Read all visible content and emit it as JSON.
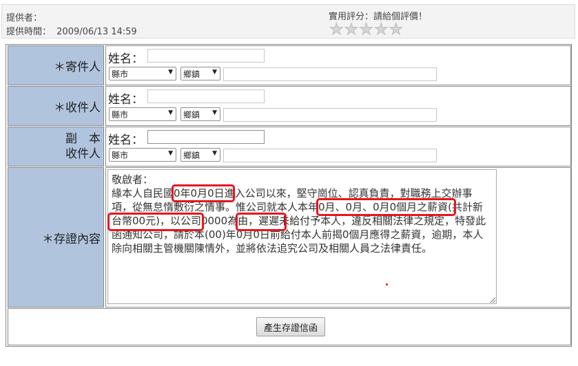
{
  "meta": {
    "provider_label": "提供者：",
    "time_label": "提供時間：",
    "time_value": "2009/06/13 14:59"
  },
  "rating": {
    "label": "實用評分：請給個評價！",
    "stars": 5,
    "value": 0
  },
  "form": {
    "sender": {
      "label": "＊寄件人",
      "name_label": "姓名：",
      "city_select": "縣市",
      "town_select": "鄉鎮"
    },
    "recipient": {
      "label": "＊收件人",
      "name_label": "姓名：",
      "city_select": "縣市",
      "town_select": "鄉鎮"
    },
    "copy": {
      "label_line1": "副　本",
      "label_line2": "收件人",
      "name_label": "姓名：",
      "city_select": "縣市",
      "town_select": "鄉鎮"
    },
    "content": {
      "label": "＊存證內容",
      "text": "敬啟者：\n緣本人自民國0年0月0日進入公司以來，堅守崗位、認真負責，對職務上交辦事項，從無怠惰敷衍之情事。惟公司就本人本年0月、0月、0月0個月之薪資(共計新台幣00元)，以公司0000為由，遲遲未給付予本人，違反相關法律之規定，特發此函通知公司，請於本(00)年0月0日前給付本人前揭0個月應得之薪資，逾期，本人除向相關主管機關陳情外，並將依法追究公司及相關人員之法律責任。"
    },
    "submit_label": "產生存證信函"
  },
  "colors": {
    "label_bg": "#b0c4de",
    "highlight": "#e8141e"
  }
}
